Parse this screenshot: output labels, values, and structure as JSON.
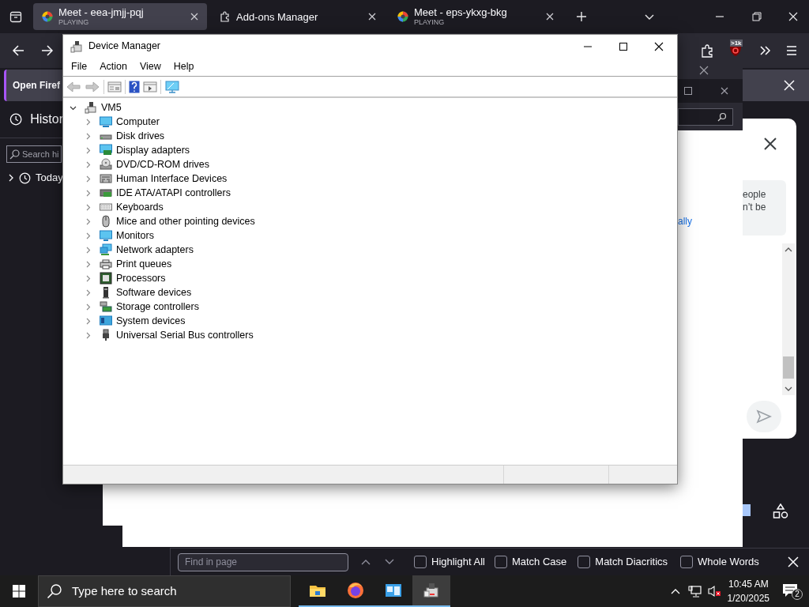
{
  "browser": {
    "tabs": [
      {
        "title": "Meet - eea-jmjj-pqj",
        "subtitle": "PLAYING",
        "kind": "meet",
        "selected": true
      },
      {
        "title": "Add-ons Manager",
        "kind": "addons",
        "selected": false
      },
      {
        "title": "Meet - eps-ykxg-bkg",
        "subtitle": "PLAYING",
        "kind": "meet",
        "selected": false
      }
    ],
    "extension_badge": ">1k",
    "notification": {
      "text": "Open Firef"
    },
    "sidebar": {
      "title": "Histor",
      "search": {
        "placeholder": "Search hi"
      },
      "items": [
        {
          "label": "Today",
          "expanded": false
        }
      ]
    },
    "page": {
      "dialog_lines": [
        "eople",
        "n’t be"
      ],
      "link": "ally"
    },
    "find_bar": {
      "placeholder": "Find in page",
      "options": [
        {
          "label": "Highlight All",
          "checked": false
        },
        {
          "label": "Match Case",
          "checked": false
        },
        {
          "label": "Match Diacritics",
          "checked": false
        },
        {
          "label": "Whole Words",
          "checked": false
        }
      ]
    }
  },
  "device_manager": {
    "title": "Device Manager",
    "menu": [
      "File",
      "Action",
      "View",
      "Help"
    ],
    "tree": {
      "label": "VM5",
      "kind": "host",
      "expanded": true,
      "children": [
        {
          "label": "Computer",
          "kind": "computer",
          "expanded": false
        },
        {
          "label": "Disk drives",
          "kind": "disk",
          "expanded": false
        },
        {
          "label": "Display adapters",
          "kind": "display",
          "expanded": false
        },
        {
          "label": "DVD/CD-ROM drives",
          "kind": "dvd",
          "expanded": false
        },
        {
          "label": "Human Interface Devices",
          "kind": "hid",
          "expanded": false
        },
        {
          "label": "IDE ATA/ATAPI controllers",
          "kind": "ide",
          "expanded": false
        },
        {
          "label": "Keyboards",
          "kind": "keyboard",
          "expanded": false
        },
        {
          "label": "Mice and other pointing devices",
          "kind": "mouse",
          "expanded": false
        },
        {
          "label": "Monitors",
          "kind": "monitor",
          "expanded": false
        },
        {
          "label": "Network adapters",
          "kind": "network",
          "expanded": false
        },
        {
          "label": "Print queues",
          "kind": "printer",
          "expanded": false
        },
        {
          "label": "Processors",
          "kind": "processor",
          "expanded": false
        },
        {
          "label": "Software devices",
          "kind": "software",
          "expanded": false
        },
        {
          "label": "Storage controllers",
          "kind": "storage",
          "expanded": false
        },
        {
          "label": "System devices",
          "kind": "system",
          "expanded": false
        },
        {
          "label": "Universal Serial Bus controllers",
          "kind": "usb",
          "expanded": false
        }
      ]
    }
  },
  "taskbar": {
    "search": {
      "placeholder": "Type here to search"
    },
    "apps": [
      {
        "kind": "folder",
        "selected": false
      },
      {
        "kind": "firefox",
        "selected": false
      },
      {
        "kind": "blueapp",
        "selected": false
      },
      {
        "kind": "devmgr",
        "selected": true
      }
    ],
    "time": "10:45 AM",
    "date": "1/20/2025",
    "notifications": "2"
  }
}
